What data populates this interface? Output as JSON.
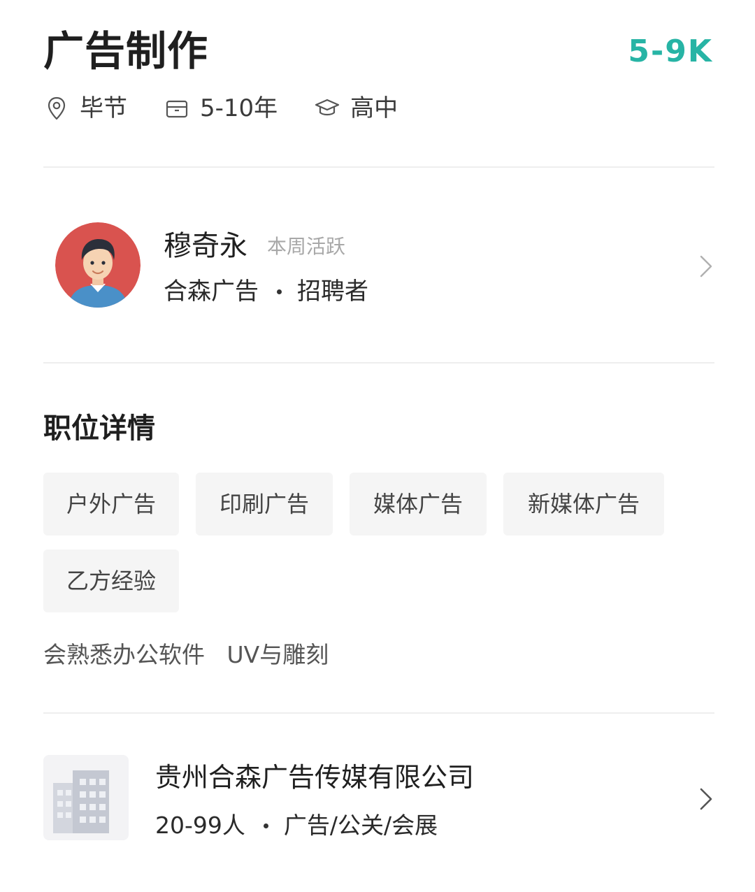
{
  "job": {
    "title": "广告制作",
    "salary": "5-9K",
    "location": "毕节",
    "experience": "5-10年",
    "education": "高中"
  },
  "recruiter": {
    "name": "穆奇永",
    "active_status": "本周活跃",
    "company": "合森广告",
    "role": "招聘者"
  },
  "details": {
    "section_title": "职位详情",
    "tags": [
      "户外广告",
      "印刷广告",
      "媒体广告",
      "新媒体广告",
      "乙方经验"
    ],
    "description": "会熟悉办公软件   UV与雕刻"
  },
  "company": {
    "name": "贵州合森广告传媒有限公司",
    "size": "20-99人",
    "industry": "广告/公关/会展"
  },
  "colors": {
    "salary": "#27b4a5",
    "avatar_bg": "#d9534f",
    "tag_bg": "#f5f5f5",
    "divider": "#eeeeee"
  },
  "icons": {
    "location": "location-pin-icon",
    "experience": "briefcase-icon",
    "education": "graduation-cap-icon",
    "chevron": "chevron-right-icon",
    "company_logo": "building-icon"
  }
}
